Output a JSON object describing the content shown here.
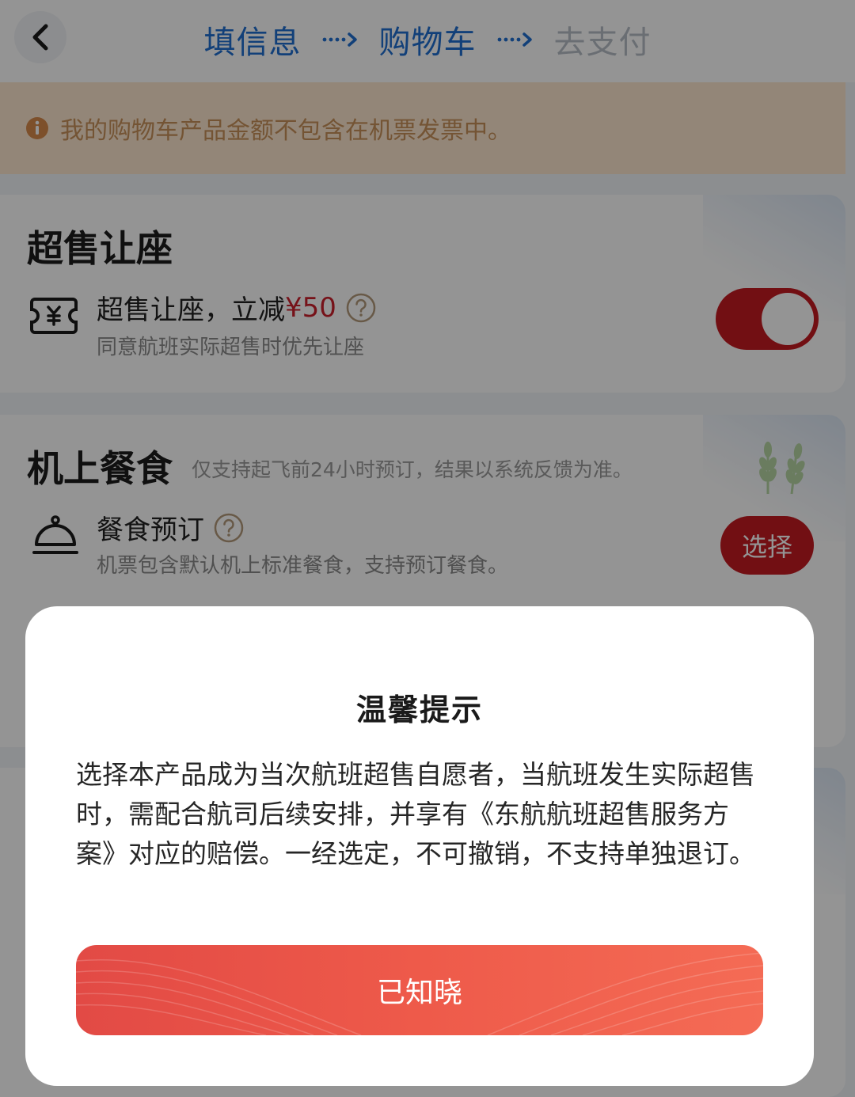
{
  "header": {
    "steps": [
      {
        "label": "填信息",
        "state": "done"
      },
      {
        "label": "购物车",
        "state": "current"
      },
      {
        "label": "去支付",
        "state": "pending"
      }
    ],
    "back_icon": "chevron-left-icon"
  },
  "notice": {
    "text": "我的购物车产品金额不包含在机票发票中。",
    "icon": "info-icon",
    "color": "#fde7cf"
  },
  "overbooking": {
    "title": "超售让座",
    "item": {
      "title_prefix": "超售让座，立减",
      "discount": "¥50",
      "subtitle": "同意航班实际超售时优先让座",
      "toggle_on": true
    }
  },
  "meal": {
    "title": "机上餐食",
    "subtitle": "仅支持起飞前24小时预订，结果以系统反馈为准。",
    "item": {
      "title": "餐食预订",
      "subtitle": "机票包含默认机上标准餐食，支持预订餐食。",
      "button": "选择"
    }
  },
  "modal": {
    "title": "温馨提示",
    "body": "选择本产品成为当次航班超售自愿者，当航班发生实际超售时，需配合航司后续安排，并享有《东航航班超售服务方案》对应的赔偿。一经选定，不可撤销，不支持单独退订。",
    "button": "已知晓"
  },
  "colors": {
    "accent_red": "#c41a22",
    "step_active": "#1f6fd1",
    "step_inactive": "#b7bec7",
    "button_gradient_start": "#e24a45",
    "button_gradient_end": "#f46b55"
  }
}
